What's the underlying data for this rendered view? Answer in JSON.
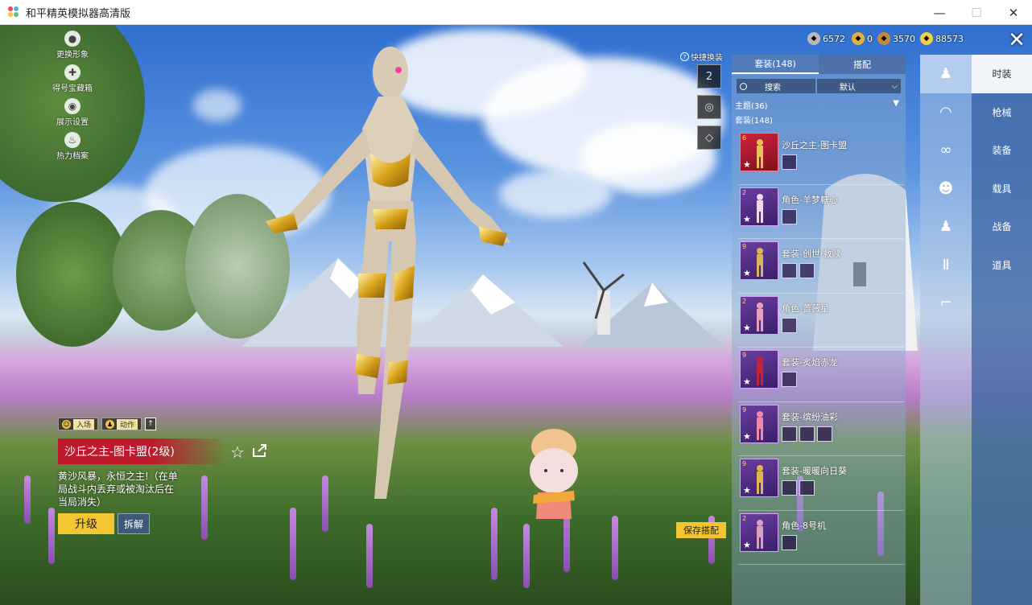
{
  "window": {
    "title": "和平精英模拟器高清版",
    "minimize": "—",
    "maximize": "☐",
    "close": "✕"
  },
  "left_menu": [
    {
      "label": "更换形象",
      "icon": "person-icon"
    },
    {
      "label": "得号宝藏箱",
      "icon": "puzzle-icon"
    },
    {
      "label": "展示设置",
      "icon": "eye-icon"
    },
    {
      "label": "热力档案",
      "icon": "fire-icon"
    }
  ],
  "actions": {
    "enter_label": "入场",
    "move_label": "动作",
    "up_arrow": "↑"
  },
  "selected_item": {
    "title": "沙丘之主-图卡盟(2级)",
    "description": "黄沙风暴，永恒之主!（在单局战斗内丢弃或被淘汰后在当局消失）",
    "upgrade": "升级",
    "dismantle": "拆解",
    "favorite_icon": "☆"
  },
  "quick_swap": {
    "label": "快捷换装",
    "slots": [
      "2",
      "◎",
      "◇"
    ]
  },
  "save_button": "保存搭配",
  "currencies": [
    {
      "icon": "coin-gray-icon",
      "value": "6572",
      "color": "#b9b9b9"
    },
    {
      "icon": "coin-gold-icon",
      "value": "0",
      "color": "#e2b13c"
    },
    {
      "icon": "coin-bronze-icon",
      "value": "3570",
      "color": "#c48a3c"
    },
    {
      "icon": "coin-yellow-icon",
      "value": "88573",
      "color": "#f3d04a"
    }
  ],
  "close_label": "✕",
  "panel": {
    "tabs": [
      {
        "label": "套装(148)",
        "active": true
      },
      {
        "label": "搭配",
        "active": false
      }
    ],
    "search_placeholder": "搜索",
    "sort_label": "默认",
    "sort_arrow": "⌵",
    "group_label": "主题(36)",
    "group_arrow": "▼",
    "count_label": "套装(148)",
    "items": [
      {
        "name": "沙丘之主-图卡盟",
        "rank": "6",
        "subs": 1,
        "highlight": true
      },
      {
        "name": "角色-羊梦糖心",
        "rank": "2",
        "subs": 1,
        "highlight": false
      },
      {
        "name": "套装-创世·救赎",
        "rank": "9",
        "subs": 2,
        "highlight": false
      },
      {
        "name": "角色-蔷薇星",
        "rank": "2",
        "subs": 1,
        "highlight": false
      },
      {
        "name": "套装-炙焰赤龙",
        "rank": "9",
        "subs": 1,
        "highlight": false
      },
      {
        "name": "套装-缤纷油彩",
        "rank": "9",
        "subs": 3,
        "highlight": false
      },
      {
        "name": "套装-暖暖向日葵",
        "rank": "9",
        "subs": 2,
        "highlight": false
      },
      {
        "name": "角色-8号机",
        "rank": "2",
        "subs": 1,
        "highlight": false
      }
    ]
  },
  "category_icons": [
    "figure-icon",
    "cap-icon",
    "goggles-icon",
    "face-icon",
    "figure-icon",
    "pants-icon",
    "shoes-icon"
  ],
  "categories": [
    {
      "label": "时装",
      "active": true
    },
    {
      "label": "枪械",
      "active": false
    },
    {
      "label": "装备",
      "active": false
    },
    {
      "label": "载具",
      "active": false
    },
    {
      "label": "战备",
      "active": false
    },
    {
      "label": "道具",
      "active": false
    }
  ]
}
